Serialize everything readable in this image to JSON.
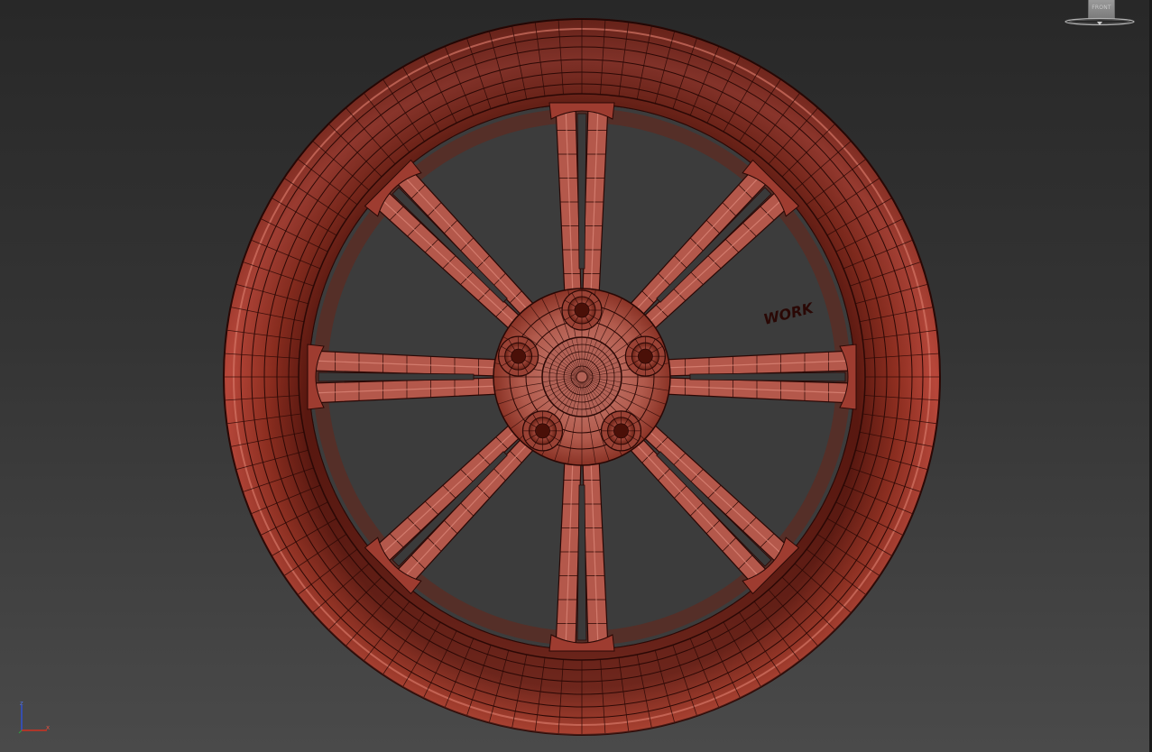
{
  "viewport": {
    "view_label": "FRONT",
    "axis_labels": {
      "x": "x",
      "z": "z"
    },
    "brand_text": "WORK",
    "spoke_count": 8,
    "lug_count": 5,
    "colors": {
      "background_top": "#282828",
      "background_bottom": "#4a4a4a",
      "model_base": "#a33a2a",
      "model_highlight": "#d06a55",
      "wireframe": "#2a0805",
      "axis_x": "#d03020",
      "axis_z": "#3050d0"
    },
    "icons": [
      "viewcube-icon",
      "axis-tripod-icon"
    ]
  }
}
